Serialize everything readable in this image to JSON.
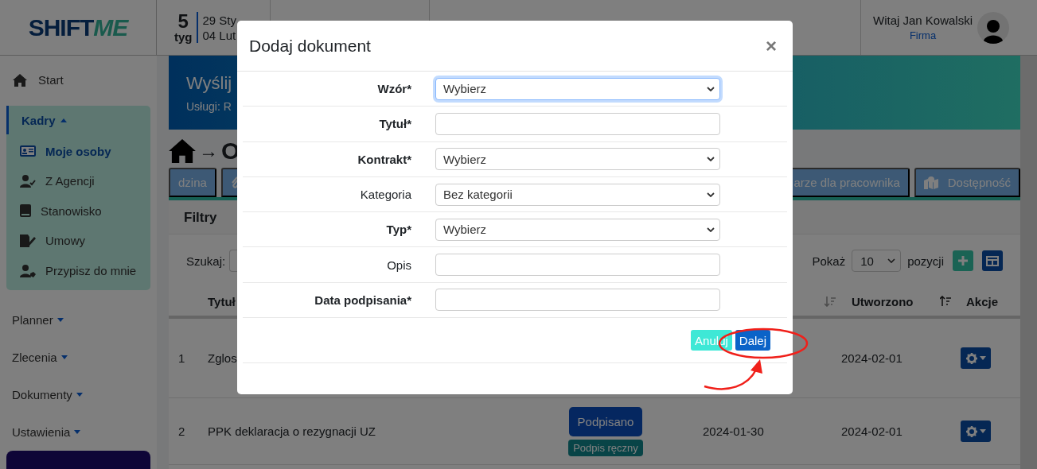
{
  "header": {
    "logo": {
      "part_1": "SHIFT",
      "part_2": "ME"
    },
    "week": {
      "number": "5",
      "unit": "tyg",
      "start": "29 Sty",
      "end": "04 Lut"
    },
    "greeting": "Witaj Jan Kowalski",
    "company": "Firma"
  },
  "sidebar": {
    "items": [
      {
        "label": "Start",
        "kind": "link"
      },
      {
        "label": "Kadry",
        "kind": "group",
        "expanded": true,
        "children": [
          {
            "label": "Moje osoby",
            "selected": true
          },
          {
            "label": "Z Agencji",
            "selected": false
          },
          {
            "label": "Stanowisko",
            "selected": false
          },
          {
            "label": "Umowy",
            "selected": false
          },
          {
            "label": "Przypisz do mnie",
            "selected": false
          }
        ]
      },
      {
        "label": "Planner",
        "kind": "group",
        "expanded": false
      },
      {
        "label": "Zlecenia",
        "kind": "group",
        "expanded": false
      },
      {
        "label": "Dokumenty",
        "kind": "group",
        "expanded": false
      },
      {
        "label": "Ustawienia",
        "kind": "group",
        "expanded": false
      }
    ]
  },
  "banner": {
    "title": "Wyślij",
    "subtitle": "Usługi: R"
  },
  "breadcrumb": {
    "separator": "→",
    "current": "O"
  },
  "tabs": [
    {
      "kind": "text",
      "label": "dzina"
    },
    {
      "kind": "icon"
    },
    {
      "kind": "text",
      "label": "arze dla pracownika"
    },
    {
      "kind": "icon-text",
      "label": "Dostępność"
    }
  ],
  "filters": {
    "title": "Filtry",
    "search_label": "Szukaj:",
    "show_label": "Pokaż",
    "page_size": "10",
    "page_size_suffix": "pozycji"
  },
  "table": {
    "columns": [
      {
        "label": "Tytuł"
      },
      {
        "label": "Utworzono"
      },
      {
        "label": "Akcje"
      }
    ],
    "rows": [
      {
        "number": "1",
        "title": "Zglos",
        "created": "2024-02-01"
      },
      {
        "number": "2",
        "title": "PPK deklaracja o rezygnacji UZ",
        "status": "Podpisano",
        "status_note": "Podpis ręczny",
        "column_4": "2024-01-30",
        "created": "2024-02-01"
      }
    ]
  },
  "modal": {
    "title": "Dodaj dokument",
    "close": "×",
    "fields": [
      {
        "label": "Wzór*",
        "kind": "select",
        "value": "Wybierz",
        "required": true,
        "focused": true
      },
      {
        "label": "Tytuł*",
        "kind": "input",
        "required": true,
        "focused": false
      },
      {
        "label": "Kontrakt*",
        "kind": "select",
        "value": "Wybierz",
        "required": true,
        "focused": false
      },
      {
        "label": "Kategoria",
        "kind": "select",
        "value": "Bez kategorii",
        "required": false,
        "focused": false
      },
      {
        "label": "Typ*",
        "kind": "select",
        "value": "Wybierz",
        "required": true,
        "focused": false
      },
      {
        "label": "Opis",
        "kind": "input",
        "required": false,
        "focused": false
      },
      {
        "label": "Data podpisania*",
        "kind": "input",
        "required": true,
        "focused": false
      }
    ],
    "buttons": [
      {
        "label": "Anuluj",
        "kind": "secondary"
      },
      {
        "label": "Dalej",
        "kind": "primary"
      }
    ]
  }
}
